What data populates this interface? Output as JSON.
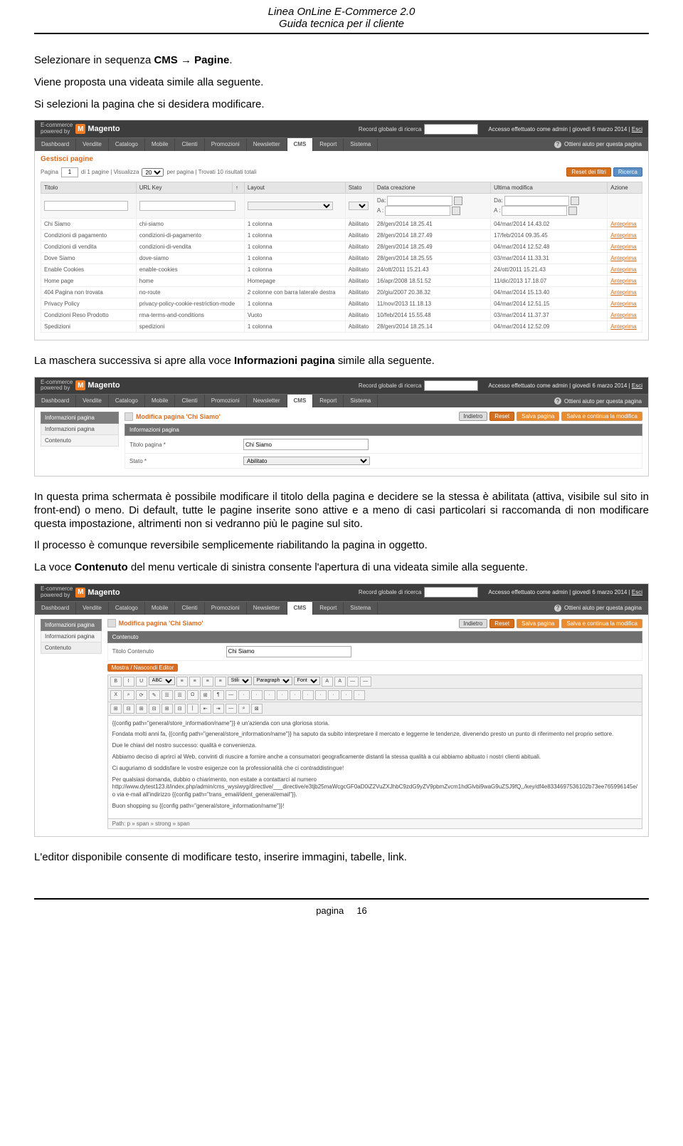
{
  "doc_header": {
    "line1": "Linea OnLine E-Commerce 2.0",
    "line2": "Guida tecnica per il cliente"
  },
  "intro": {
    "p1_pre": "Selezionare in sequenza ",
    "p1_cms": "CMS",
    "p1_arrow": " → ",
    "p1_pagine": "Pagine",
    "p1_post": ".",
    "p2": "Viene proposta una videata simile alla seguente.",
    "p3": "Si selezioni la pagina che si desidera modificare."
  },
  "mock_common": {
    "powered": "E-commerce\npowered by",
    "logo_m": "M",
    "logo_text": "Magento",
    "search_label": "Record globale di ricerca",
    "access": "Accesso effettuato come admin   |  giovedì 6 marzo 2014   |  ",
    "logout": "Esci",
    "menu": [
      "Dashboard",
      "Vendite",
      "Catalogo",
      "Mobile",
      "Clienti",
      "Promozioni",
      "Newsletter",
      "CMS",
      "Report",
      "Sistema"
    ],
    "help": "Ottieni aiuto per questa pagina"
  },
  "mock1": {
    "title": "Gestisci pagine",
    "pager_pagina": "Pagina",
    "pager_page_val": "1",
    "pager_di": "di 1 pagine  |  Visualizza",
    "pager_perpage_val": "20",
    "pager_tail": "per pagina  |  Trovati 10 risultati totali",
    "reset_btn": "Reset dei filtri",
    "search_btn": "Ricerca",
    "cols": [
      "Titolo",
      "URL Key",
      "",
      "Layout",
      "Stato",
      "Data creazione",
      "Ultima modifica",
      "Azione"
    ],
    "filter_da": "Da:",
    "filter_a": "A :",
    "rows": [
      {
        "t": "Chi Siamo",
        "u": "chi-siamo",
        "l": "1 colonna",
        "s": "Abilitato",
        "dc": "28/gen/2014 18.25.41",
        "um": "04/mar/2014 14.43.02",
        "a": "Anteprima"
      },
      {
        "t": "Condizioni di pagamento",
        "u": "condizioni-di-pagamento",
        "l": "1 colonna",
        "s": "Abilitato",
        "dc": "28/gen/2014 18.27.49",
        "um": "17/feb/2014 09.35.45",
        "a": "Anteprima"
      },
      {
        "t": "Condizioni di vendita",
        "u": "condizioni-di-vendita",
        "l": "1 colonna",
        "s": "Abilitato",
        "dc": "28/gen/2014 18.25.49",
        "um": "04/mar/2014 12.52.48",
        "a": "Anteprima"
      },
      {
        "t": "Dove Siamo",
        "u": "dove-siamo",
        "l": "1 colonna",
        "s": "Abilitato",
        "dc": "28/gen/2014 18.25.55",
        "um": "03/mar/2014 11.33.31",
        "a": "Anteprima"
      },
      {
        "t": "Enable Cookies",
        "u": "enable-cookies",
        "l": "1 colonna",
        "s": "Abilitato",
        "dc": "24/ott/2011 15.21.43",
        "um": "24/ott/2011 15.21.43",
        "a": "Anteprima"
      },
      {
        "t": "Home page",
        "u": "home",
        "l": "Homepage",
        "s": "Abilitato",
        "dc": "16/apr/2008 18.51.52",
        "um": "11/dic/2013 17.18.07",
        "a": "Anteprima"
      },
      {
        "t": "404 Pagina non trovata",
        "u": "no-route",
        "l": "2 colonne con barra laterale destra",
        "s": "Abilitato",
        "dc": "20/giu/2007 20.38.32",
        "um": "04/mar/2014 15.13.40",
        "a": "Anteprima"
      },
      {
        "t": "Privacy Policy",
        "u": "privacy-policy-cookie-restriction-mode",
        "l": "1 colonna",
        "s": "Abilitato",
        "dc": "11/nov/2013 11.18.13",
        "um": "04/mar/2014 12.51.15",
        "a": "Anteprima"
      },
      {
        "t": "Condizioni Reso Prodotto",
        "u": "rma-terms-and-conditions",
        "l": "Vuoto",
        "s": "Abilitato",
        "dc": "10/feb/2014 15.55.48",
        "um": "03/mar/2014 11.37.37",
        "a": "Anteprima"
      },
      {
        "t": "Spedizioni",
        "u": "spedizioni",
        "l": "1 colonna",
        "s": "Abilitato",
        "dc": "28/gen/2014 18.25.14",
        "um": "04/mar/2014 12.52.09",
        "a": "Anteprima"
      }
    ]
  },
  "between1": {
    "p1_pre": "La maschera successiva si apre alla voce ",
    "p1_bold": "Informazioni pagina",
    "p1_post": " simile alla seguente."
  },
  "mock2": {
    "sidebar_title": "Informazioni pagina",
    "sidebar_items": [
      "Informazioni pagina",
      "Contenuto"
    ],
    "page_title": "Modifica pagina 'Chi Siamo'",
    "btn_back": "Indietro",
    "btn_reset": "Reset",
    "btn_save": "Salva pagina",
    "btn_savecont": "Salva e continua la modifica",
    "section": "Informazioni pagina",
    "field_title_lbl": "Titolo pagina *",
    "field_title_val": "Chi Siamo",
    "field_state_lbl": "Stato *",
    "field_state_val": "Abilitato"
  },
  "between2": {
    "p1": "In questa prima schermata è possibile modificare il titolo della pagina e decidere se la stessa è abilitata (attiva, visibile sul sito in front-end) o meno. Di default, tutte le pagine inserite sono attive e a meno di casi particolari si raccomanda di non modificare questa impostazione, altrimenti non si vedranno più le pagine sul sito.",
    "p2": "Il processo è comunque reversibile semplicemente riabilitando la pagina in oggetto.",
    "p3_pre": "La voce ",
    "p3_bold": "Contenuto",
    "p3_post": " del menu verticale di sinistra consente l'apertura di una videata simile alla seguente."
  },
  "mock3": {
    "sidebar_title": "Informazioni pagina",
    "sidebar_items": [
      "Informazioni pagina",
      "Contenuto"
    ],
    "page_title": "Modifica pagina 'Chi Siamo'",
    "btn_back": "Indietro",
    "btn_reset": "Reset",
    "btn_save": "Salva pagina",
    "btn_savecont": "Salva e continua la modifica",
    "section": "Contenuto",
    "field_title_lbl": "Titolo Contenuto",
    "field_title_val": "Chi Siamo",
    "hide_editor": "Mostra / Nascondi Editor",
    "tbtn_labels": [
      "B",
      "I",
      "U",
      "ABC",
      "≡",
      "≡",
      "≡",
      "≡",
      "Stili",
      "Paragraph",
      "Font",
      "A",
      "A",
      "—",
      "—"
    ],
    "tbtn_row2": [
      "X",
      "⌕",
      "⟳",
      "✎",
      "☰",
      "☰",
      "Ω",
      "⊞",
      "¶",
      "—",
      "·",
      "·",
      "·",
      "·",
      "·",
      "·",
      "·",
      "·",
      "·",
      "·"
    ],
    "tbtn_row3": [
      "⊞",
      "⊟",
      "⊞",
      "⊟",
      "⊞",
      "⊟",
      "|",
      "⇤",
      "⇥",
      "—",
      "⌕",
      "⊠"
    ],
    "editor_paragraphs": [
      "{{config path=\"general/store_information/name\"}} è un'azienda con una gloriosa storia.",
      "Fondata molti anni fa, {{config path=\"general/store_information/name\"}} ha saputo da subito interpretare il mercato e leggerne le tendenze, divenendo presto un punto di riferimento nel proprio settore.",
      "Due le chiavi del nostro successo: qualità e convenienza.",
      "Abbiamo deciso di aprirci al Web, convinti di riuscire a fornire anche a consumatori geograficamente distanti la stessa qualità a cui abbiamo abituato i nostri clienti abituali.",
      "Ci auguriamo di soddisfare le vostre esigenze con la professionalità che ci contraddistingue!",
      "Per qualsiasi domanda, dubbio o chiarimento, non esitate a contattarci al numero http://www.dytest123.it/index.php/admin/cms_wysiwyg/directive/___directive/e3tjb25maWcgcGF0aD0iZ2VuZXJhbC9zdG9yZV9pbmZvcm1hdGlvbi9waG9uZSJ9fQ,,/key/df4e8334697536102b73ee765996145e/ o via e-mail all'indirizzo {{config path=\"trans_email/ident_general/email\"}}.",
      "Buon shopping su {{config path=\"general/store_information/name\"}}!"
    ],
    "path": "Path: p » span » strong » span"
  },
  "closing": "L'editor disponibile consente di modificare testo, inserire immagini, tabelle, link.",
  "footer_label": "pagina",
  "footer_num": "16"
}
